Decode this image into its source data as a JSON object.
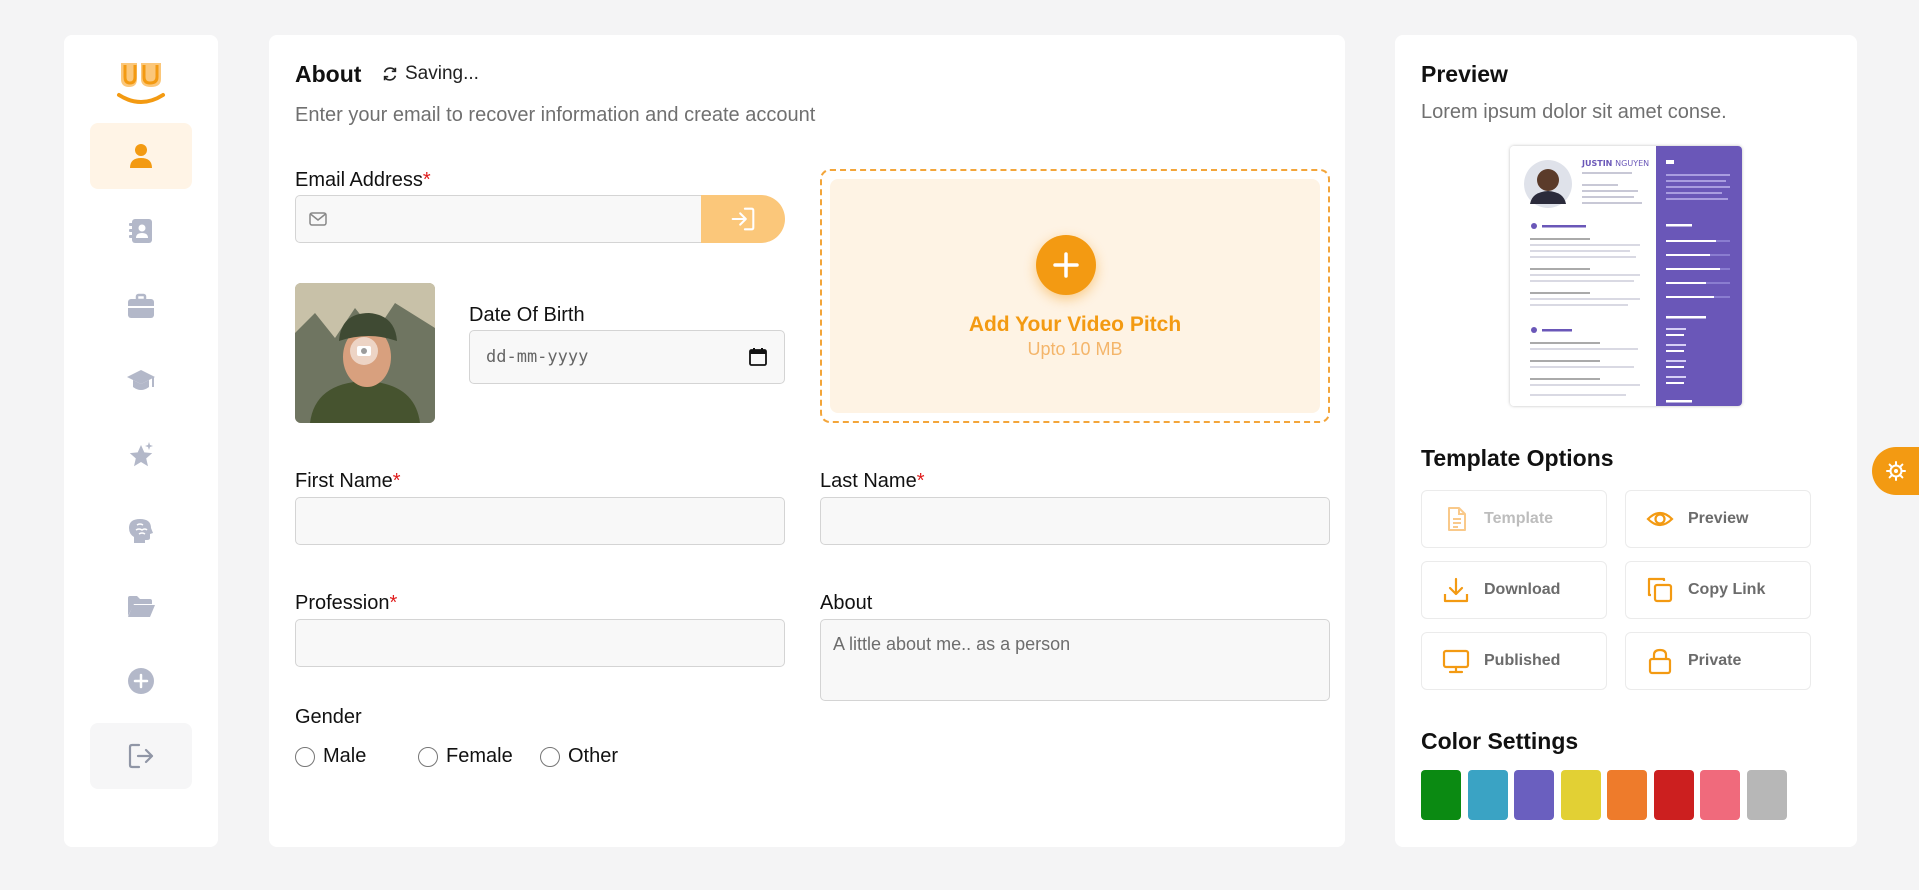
{
  "about": {
    "title": "About",
    "saving_status": "Saving...",
    "subtitle": "Enter your email to recover information and create account",
    "email_label": "Email Address",
    "required_mark": "*",
    "dob_label": "Date Of Birth",
    "dob_placeholder": "dd-mm-yyyy",
    "video_title": "Add Your Video Pitch",
    "video_sub": "Upto 10 MB",
    "first_name_label": "First Name",
    "last_name_label": "Last Name",
    "profession_label": "Profession",
    "about_label": "About",
    "about_placeholder": "A little about me.. as a person",
    "gender_label": "Gender",
    "gender_options": [
      "Male",
      "Female",
      "Other"
    ]
  },
  "sidebar": {
    "items": [
      "profile-icon",
      "contacts-icon",
      "briefcase-icon",
      "graduation-cap-icon",
      "star-icon",
      "brain-icon",
      "folder-open-icon",
      "add-circle-icon",
      "logout-icon"
    ],
    "active": "profile-icon"
  },
  "preview": {
    "title": "Preview",
    "subtitle": "Lorem ipsum dolor sit amet conse.",
    "resume_name_first": "JUSTIN",
    "resume_name_last": "NGUYEN"
  },
  "template_options": {
    "title": "Template Options",
    "buttons": [
      "Template",
      "Preview",
      "Download",
      "Copy Link",
      "Published",
      "Private"
    ]
  },
  "color_settings": {
    "title": "Color Settings",
    "colors": [
      "#0b8a12",
      "#3aa3c4",
      "#6a5fbf",
      "#e2d034",
      "#ee7b2b",
      "#cc1f1f",
      "#f06a7c",
      "#b7b7b7"
    ]
  },
  "theme": {
    "accent": "#f39a12",
    "icon_gray": "#b3b8c9"
  }
}
